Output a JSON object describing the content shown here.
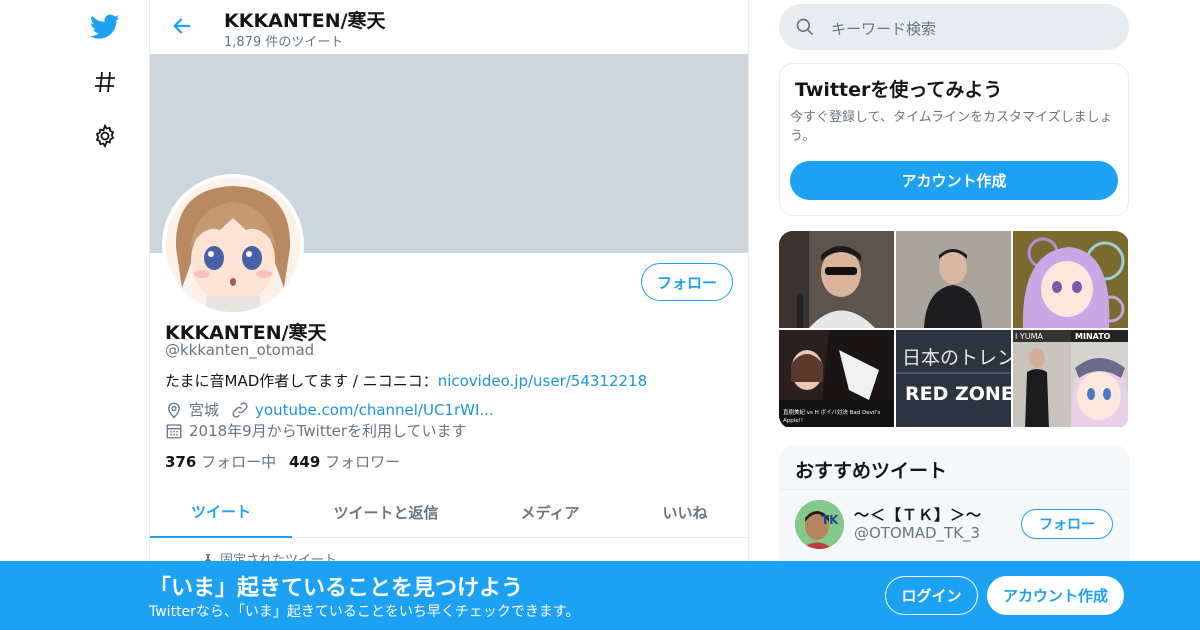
{
  "header": {
    "title": "KKKANTEN/寒天",
    "tweet_count": "1,879 件のツイート"
  },
  "profile": {
    "name": "KKKANTEN/寒天",
    "handle": "@kkkanten_otomad",
    "bio_text": "たまに音MAD作者してます / ニコニコ：",
    "bio_link": "nicovideo.jp/user/54312218",
    "location": "宮城",
    "website": "youtube.com/channel/UC1rWI...",
    "joined": "2018年9月からTwitterを利用しています",
    "following_count": "376",
    "following_label": "フォロー中",
    "followers_count": "449",
    "followers_label": "フォロワー",
    "follow_label": "フォロー"
  },
  "tabs": [
    {
      "label": "ツイート"
    },
    {
      "label": "ツイートと返信"
    },
    {
      "label": "メディア"
    },
    {
      "label": "いいね"
    }
  ],
  "pinned_label": "固定されたツイート",
  "search": {
    "placeholder": "キーワード検索"
  },
  "signup_card": {
    "title": "Twitterを使ってみよう",
    "text": "今すぐ登録して、タイムラインをカスタマイズしましょう。",
    "button": "アカウント作成"
  },
  "media_texts": {
    "red_zone": "RED ZONE",
    "nihon": "日本のトレン",
    "yuma": "I YUMA",
    "minato": "MINATO"
  },
  "recommend": {
    "title": "おすすめツイート",
    "user_name": "～＜【ＴＫ】＞～",
    "user_handle": "@OTOMAD_TK_3",
    "avatar_text": "TK",
    "follow": "フォロー"
  },
  "bottom_bar": {
    "title": "「いま」起きていることを見つけよう",
    "subtitle": "Twitterなら、「いま」起きていることをいち早くチェックできます。",
    "login": "ログイン",
    "signup": "アカウント作成"
  },
  "colors": {
    "accent": "#1da1f2",
    "banner": "#ccd6dd",
    "link": "#1b95e0"
  },
  "icons": [
    "twitter-logo-icon",
    "hashtag-icon",
    "gear-icon",
    "back-arrow-icon",
    "search-icon",
    "location-icon",
    "link-icon",
    "calendar-icon",
    "pin-icon"
  ]
}
